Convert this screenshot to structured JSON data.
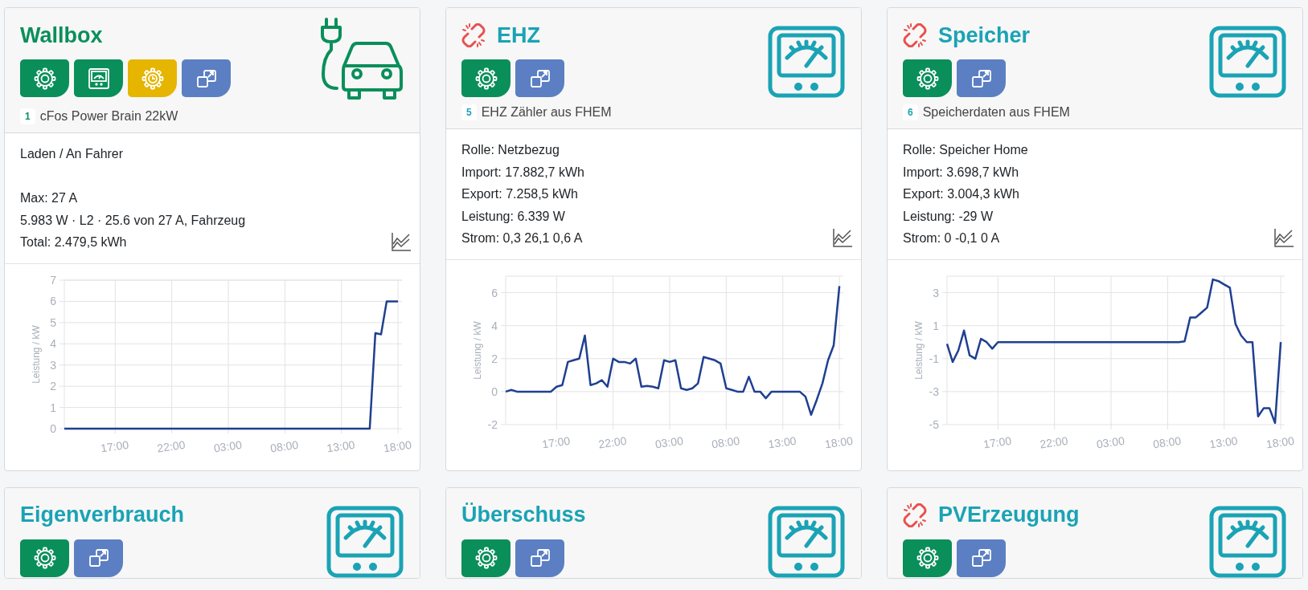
{
  "cards": [
    {
      "title": "Wallbox",
      "color": "#0a8f5a",
      "link_broken": false,
      "kind": "car",
      "buttons": [
        {
          "kind": "settings"
        },
        {
          "kind": "meter"
        },
        {
          "kind": "schedule"
        },
        {
          "kind": "popout"
        }
      ],
      "badge": "1",
      "subtitle": "cFos Power Brain 22kW",
      "lines": [
        {
          "text": "Laden / An Fahrer",
          "gap_after": true
        },
        {
          "text": "Max: 27 A",
          "gap_after": false
        },
        {
          "text": "5.983 W · L2 · 25.6 von 27 A, Fahrzeug",
          "gap_after": false
        },
        {
          "text": "Total: 2.479,5 kWh",
          "gap_after": false
        }
      ],
      "chart_data": {
        "type": "line",
        "grid": true,
        "ylabel": "Leistung / kW",
        "categories": [
          null,
          null,
          null,
          null,
          null,
          null,
          null,
          null,
          null,
          "17:00",
          null,
          null,
          null,
          null,
          null,
          null,
          null,
          null,
          null,
          "22:00",
          null,
          null,
          null,
          null,
          null,
          null,
          null,
          null,
          null,
          "03:00",
          null,
          null,
          null,
          null,
          null,
          null,
          null,
          null,
          null,
          "08:00",
          null,
          null,
          null,
          null,
          null,
          null,
          null,
          null,
          null,
          "13:00",
          null,
          null,
          null,
          null,
          null,
          null,
          null,
          null,
          null,
          "18:00"
        ],
        "series": [
          {
            "color": "#1f3f91",
            "values": [
              0,
              0,
              0,
              0,
              0,
              0,
              0,
              0,
              0,
              0,
              0,
              0,
              0,
              0,
              0,
              0,
              0,
              0,
              0,
              0,
              0,
              0,
              0,
              0,
              0,
              0,
              0,
              0,
              0,
              0,
              0,
              0,
              0,
              0,
              0,
              0,
              0,
              0,
              0,
              0,
              0,
              0,
              0,
              0,
              0,
              0,
              0,
              0,
              0,
              0,
              0,
              0,
              0,
              0,
              0,
              4.5,
              4.45,
              6,
              6,
              6
            ]
          }
        ],
        "ylim": [
          0,
          7
        ],
        "yticks": [
          0,
          1,
          2,
          3,
          4,
          5,
          6,
          7
        ]
      }
    },
    {
      "title": "EHZ",
      "color": "#1aa3b5",
      "link_broken": true,
      "kind": "meter",
      "buttons": [
        {
          "kind": "settings"
        },
        {
          "kind": "popout"
        }
      ],
      "badge": "5",
      "subtitle": "EHZ Zähler aus FHEM",
      "lines": [
        {
          "text": "Rolle: Netzbezug",
          "gap_after": false
        },
        {
          "text": "Import: 17.882,7 kWh",
          "gap_after": false
        },
        {
          "text": "Export: 7.258,5 kWh",
          "gap_after": false
        },
        {
          "text": "Leistung: 6.339 W",
          "gap_after": false
        },
        {
          "text": "Strom: 0,3 26,1 0,6 A",
          "gap_after": false
        }
      ],
      "chart_data": {
        "type": "line",
        "grid": true,
        "ylabel": "Leistung / kW",
        "categories": [
          null,
          null,
          null,
          null,
          null,
          null,
          null,
          null,
          null,
          "17:00",
          null,
          null,
          null,
          null,
          null,
          null,
          null,
          null,
          null,
          "22:00",
          null,
          null,
          null,
          null,
          null,
          null,
          null,
          null,
          null,
          "03:00",
          null,
          null,
          null,
          null,
          null,
          null,
          null,
          null,
          null,
          "08:00",
          null,
          null,
          null,
          null,
          null,
          null,
          null,
          null,
          null,
          "13:00",
          null,
          null,
          null,
          null,
          null,
          null,
          null,
          null,
          null,
          "18:00"
        ],
        "series": [
          {
            "color": "#1f3f91",
            "values": [
              0,
              0.1,
              0,
              0,
              0,
              0,
              0,
              0,
              0,
              0.3,
              0.4,
              1.8,
              1.9,
              2.0,
              3.4,
              0.4,
              0.5,
              0.7,
              0.3,
              2.0,
              1.8,
              1.8,
              1.7,
              2.0,
              0.3,
              0.35,
              0.3,
              0.2,
              1.9,
              1.8,
              1.9,
              0.2,
              0.1,
              0.2,
              0.5,
              2.1,
              2.0,
              1.9,
              1.7,
              0.2,
              0.1,
              0,
              0,
              0.9,
              0,
              0,
              -0.4,
              0,
              0,
              0,
              0,
              0,
              0,
              -0.3,
              -1.4,
              -0.5,
              0.5,
              1.9,
              2.8,
              6.4
            ]
          }
        ],
        "ylim": [
          -2,
          7
        ],
        "yticks": [
          -2,
          0,
          2,
          4,
          6
        ]
      }
    },
    {
      "title": "Speicher",
      "color": "#1aa3b5",
      "link_broken": true,
      "kind": "meter",
      "buttons": [
        {
          "kind": "settings"
        },
        {
          "kind": "popout"
        }
      ],
      "badge": "6",
      "subtitle": "Speicherdaten aus FHEM",
      "lines": [
        {
          "text": "Rolle: Speicher Home",
          "gap_after": false
        },
        {
          "text": "Import: 3.698,7 kWh",
          "gap_after": false
        },
        {
          "text": "Export: 3.004,3 kWh",
          "gap_after": false
        },
        {
          "text": "Leistung: -29 W",
          "gap_after": false
        },
        {
          "text": "Strom: 0 -0,1 0 A",
          "gap_after": false
        }
      ],
      "chart_data": {
        "type": "line",
        "grid": true,
        "ylabel": "Leistung / kW",
        "categories": [
          null,
          null,
          null,
          null,
          null,
          null,
          null,
          null,
          null,
          "17:00",
          null,
          null,
          null,
          null,
          null,
          null,
          null,
          null,
          null,
          "22:00",
          null,
          null,
          null,
          null,
          null,
          null,
          null,
          null,
          null,
          "03:00",
          null,
          null,
          null,
          null,
          null,
          null,
          null,
          null,
          null,
          "08:00",
          null,
          null,
          null,
          null,
          null,
          null,
          null,
          null,
          null,
          "13:00",
          null,
          null,
          null,
          null,
          null,
          null,
          null,
          null,
          null,
          "18:00"
        ],
        "series": [
          {
            "color": "#1f3f91",
            "values": [
              -0.1,
              -1.2,
              -0.5,
              0.7,
              -0.8,
              -1.0,
              0.2,
              0,
              -0.4,
              0,
              0,
              0,
              0,
              0,
              0,
              0,
              0,
              0,
              0,
              0,
              0,
              0,
              0,
              0,
              0,
              0,
              0,
              0,
              0,
              0,
              0,
              0,
              0,
              0,
              0,
              0,
              0,
              0,
              0,
              0,
              0,
              0,
              0.05,
              1.5,
              1.5,
              1.8,
              2.1,
              3.8,
              3.7,
              3.5,
              3.3,
              1.1,
              0.4,
              0,
              0,
              -4.5,
              -4.0,
              -4.0,
              -4.9,
              0
            ]
          }
        ],
        "ylim": [
          -5,
          4
        ],
        "yticks": [
          -5,
          -3,
          -1,
          1,
          3
        ]
      }
    },
    {
      "title": "Eigenverbrauch",
      "color": "#1aa3b5",
      "link_broken": false,
      "kind": "meter",
      "buttons": [
        {
          "kind": "settings"
        },
        {
          "kind": "popout"
        }
      ]
    },
    {
      "title": "Überschuss",
      "color": "#1aa3b5",
      "link_broken": false,
      "kind": "meter",
      "buttons": [
        {
          "kind": "settings"
        },
        {
          "kind": "popout"
        }
      ]
    },
    {
      "title": "PVErzeugung",
      "color": "#1aa3b5",
      "link_broken": true,
      "kind": "meter",
      "buttons": [
        {
          "kind": "settings"
        },
        {
          "kind": "popout"
        }
      ]
    }
  ]
}
